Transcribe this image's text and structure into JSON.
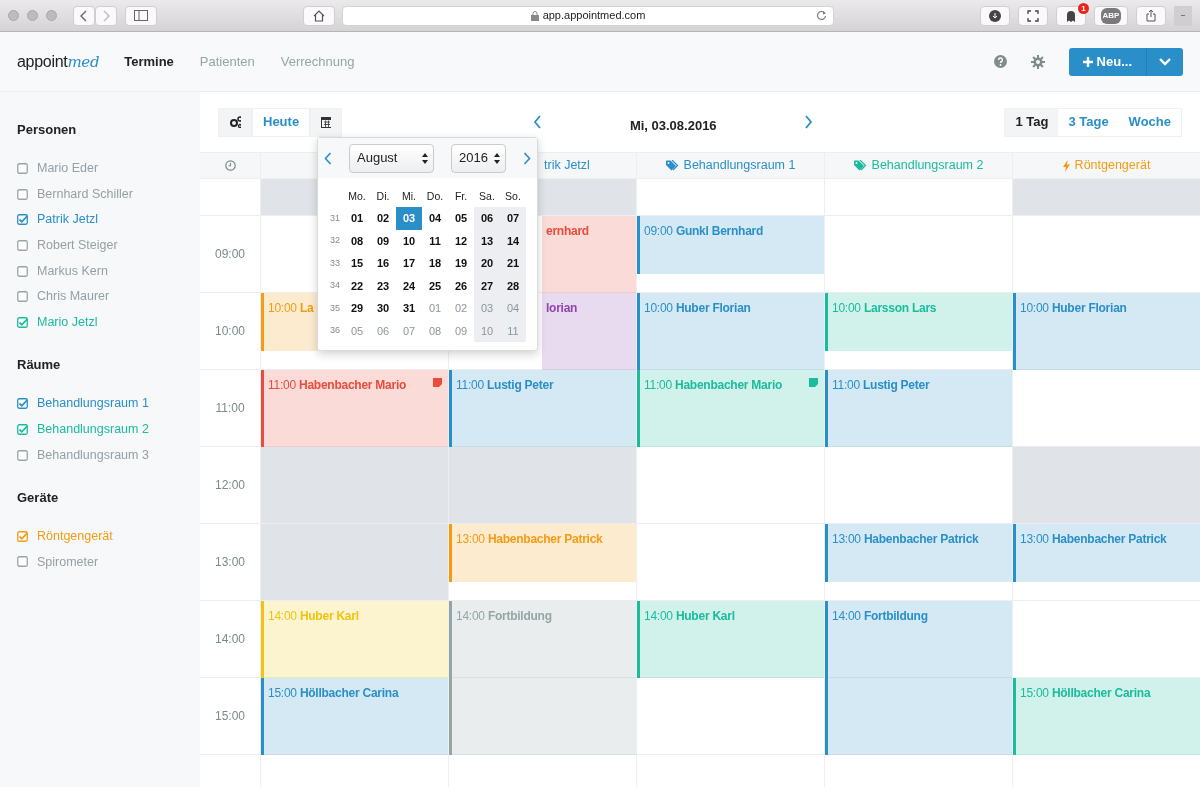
{
  "browser": {
    "url": "app.appointmed.com",
    "notification_count": "1",
    "adblock_label": "ABP"
  },
  "app_nav": {
    "logo": {
      "main": "appoint",
      "accent": "med"
    },
    "items": [
      {
        "label": "Termine",
        "selected": true
      },
      {
        "label": "Patienten",
        "selected": false
      },
      {
        "label": "Verrechnung",
        "selected": false
      }
    ],
    "new_button": {
      "label": "Neu..."
    }
  },
  "sidebar": {
    "sections": [
      {
        "title": "Personen",
        "items": [
          {
            "label": "Mario Eder",
            "checked": false
          },
          {
            "label": "Bernhard Schiller",
            "checked": false
          },
          {
            "label": "Patrik Jetzl",
            "checked": true,
            "color": "#2a8fc8"
          },
          {
            "label": "Robert Steiger",
            "checked": false
          },
          {
            "label": "Markus Kern",
            "checked": false
          },
          {
            "label": "Chris Maurer",
            "checked": false
          },
          {
            "label": "Mario Jetzl",
            "checked": true,
            "color": "#1abc9c"
          }
        ]
      },
      {
        "title": "Räume",
        "items": [
          {
            "label": "Behandlungsraum 1",
            "checked": true,
            "color": "#2a8fc8"
          },
          {
            "label": "Behandlungsraum 2",
            "checked": true,
            "color": "#1abc9c"
          },
          {
            "label": "Behandlungsraum 3",
            "checked": false
          }
        ]
      },
      {
        "title": "Geräte",
        "items": [
          {
            "label": "Röntgengerät",
            "checked": true,
            "color": "#f39c12"
          },
          {
            "label": "Spirometer",
            "checked": false
          }
        ]
      }
    ]
  },
  "toolbar": {
    "today_button": "Heute",
    "date": "Mi, 03.08.2016",
    "views": [
      {
        "label": "1 Tag",
        "selected": true
      },
      {
        "label": "3 Tage",
        "selected": false
      },
      {
        "label": "Woche",
        "selected": false
      }
    ]
  },
  "datepicker": {
    "month": "August",
    "year": "2016",
    "weekdays": [
      "Mo.",
      "Di.",
      "Mi.",
      "Do.",
      "Fr.",
      "Sa.",
      "So."
    ],
    "weeks": [
      {
        "week": "31",
        "days": [
          {
            "label": "01",
            "muted": false,
            "selected": false
          },
          {
            "label": "02",
            "muted": false,
            "selected": false
          },
          {
            "label": "03",
            "muted": false,
            "selected": true
          },
          {
            "label": "04",
            "muted": false,
            "selected": false
          },
          {
            "label": "05",
            "muted": false,
            "selected": false
          },
          {
            "label": "06",
            "muted": false,
            "selected": false
          },
          {
            "label": "07",
            "muted": false,
            "selected": false
          }
        ]
      },
      {
        "week": "32",
        "days": [
          {
            "label": "08",
            "muted": false,
            "selected": false
          },
          {
            "label": "09",
            "muted": false,
            "selected": false
          },
          {
            "label": "10",
            "muted": false,
            "selected": false
          },
          {
            "label": "11",
            "muted": false,
            "selected": false
          },
          {
            "label": "12",
            "muted": false,
            "selected": false
          },
          {
            "label": "13",
            "muted": false,
            "selected": false
          },
          {
            "label": "14",
            "muted": false,
            "selected": false
          }
        ]
      },
      {
        "week": "33",
        "days": [
          {
            "label": "15",
            "muted": false,
            "selected": false
          },
          {
            "label": "16",
            "muted": false,
            "selected": false
          },
          {
            "label": "17",
            "muted": false,
            "selected": false
          },
          {
            "label": "18",
            "muted": false,
            "selected": false
          },
          {
            "label": "19",
            "muted": false,
            "selected": false
          },
          {
            "label": "20",
            "muted": false,
            "selected": false
          },
          {
            "label": "21",
            "muted": false,
            "selected": false
          }
        ]
      },
      {
        "week": "34",
        "days": [
          {
            "label": "22",
            "muted": false,
            "selected": false
          },
          {
            "label": "23",
            "muted": false,
            "selected": false
          },
          {
            "label": "24",
            "muted": false,
            "selected": false
          },
          {
            "label": "25",
            "muted": false,
            "selected": false
          },
          {
            "label": "26",
            "muted": false,
            "selected": false
          },
          {
            "label": "27",
            "muted": false,
            "selected": false
          },
          {
            "label": "28",
            "muted": false,
            "selected": false
          }
        ]
      },
      {
        "week": "35",
        "days": [
          {
            "label": "29",
            "muted": false,
            "selected": false
          },
          {
            "label": "30",
            "muted": false,
            "selected": false
          },
          {
            "label": "31",
            "muted": false,
            "selected": false
          },
          {
            "label": "01",
            "muted": true,
            "selected": false
          },
          {
            "label": "02",
            "muted": true,
            "selected": false
          },
          {
            "label": "03",
            "muted": true,
            "selected": false
          },
          {
            "label": "04",
            "muted": true,
            "selected": false
          }
        ]
      },
      {
        "week": "36",
        "days": [
          {
            "label": "05",
            "muted": true,
            "selected": false
          },
          {
            "label": "06",
            "muted": true,
            "selected": false
          },
          {
            "label": "07",
            "muted": true,
            "selected": false
          },
          {
            "label": "08",
            "muted": true,
            "selected": false
          },
          {
            "label": "09",
            "muted": true,
            "selected": false
          },
          {
            "label": "10",
            "muted": true,
            "selected": false
          },
          {
            "label": "11",
            "muted": true,
            "selected": false
          }
        ]
      }
    ]
  },
  "calendar": {
    "columns": [
      {
        "kind": "hidden"
      },
      {
        "kind": "covered",
        "label": "trik Jetzl",
        "color": "#2a8fc8"
      },
      {
        "kind": "tag",
        "label": "Behandlungsraum 1",
        "color": "#2a8fc8"
      },
      {
        "kind": "tag",
        "label": "Behandlungsraum 2",
        "color": "#1abc9c"
      },
      {
        "kind": "bolt",
        "label": "Röntgengerät",
        "color": "#f39c12"
      }
    ],
    "all_day": [
      {
        "shaded": true
      },
      {
        "shaded": true
      },
      {
        "shaded": false
      },
      {
        "shaded": false
      },
      {
        "shaded": true
      }
    ],
    "rows": [
      {
        "time": "09:00",
        "cells": [
          {
            "shaded": false
          },
          {
            "event": {
              "name": "ernhard",
              "color": "#e74c3c",
              "kind": "hour",
              "note": false
            }
          },
          {
            "event": {
              "time": "09:00",
              "name": "Gunkl Bernhard",
              "color": "#2a8fc8",
              "kind": "short",
              "note": false
            }
          },
          {
            "shaded": false
          },
          {
            "shaded": false
          }
        ]
      },
      {
        "time": "10:00",
        "cells": [
          {
            "event": {
              "time": "10:00",
              "name": "La",
              "color": "#f39c12",
              "kind": "short"
            }
          },
          {
            "event": {
              "name": "lorian",
              "color": "#8e44ad",
              "kind": "hour",
              "note": false
            }
          },
          {
            "event": {
              "time": "10:00",
              "name": "Huber Florian",
              "color": "#2a8fc8",
              "kind": "hour",
              "note": false
            }
          },
          {
            "event": {
              "time": "10:00",
              "name": "Larsson Lars",
              "color": "#1abc9c",
              "kind": "short",
              "note": false
            }
          },
          {
            "event": {
              "time": "10:00",
              "name": "Huber Florian",
              "color": "#2a8fc8",
              "kind": "hour",
              "note": false
            }
          }
        ]
      },
      {
        "time": "11:00",
        "cells": [
          {
            "event": {
              "time": "11:00",
              "name": "Habenbacher Mario",
              "color": "#e74c3c",
              "kind": "hour",
              "note": true
            }
          },
          {
            "event": {
              "time": "11:00",
              "name": "Lustig Peter",
              "color": "#2a8fc8",
              "kind": "hour",
              "note": false
            }
          },
          {
            "event": {
              "time": "11:00",
              "name": "Habenbacher Mario",
              "color": "#1abc9c",
              "kind": "hour",
              "note": true
            }
          },
          {
            "event": {
              "time": "11:00",
              "name": "Lustig Peter",
              "color": "#2a8fc8",
              "kind": "hour",
              "note": false
            }
          },
          {
            "shaded": false
          }
        ]
      },
      {
        "time": "12:00",
        "cells": [
          {
            "shaded": true
          },
          {
            "shaded": true
          },
          {
            "shaded": false
          },
          {
            "shaded": false
          },
          {
            "shaded": true
          }
        ]
      },
      {
        "time": "13:00",
        "cells": [
          {
            "shaded": true
          },
          {
            "event": {
              "time": "13:00",
              "name": "Habenbacher Patrick",
              "color": "#f39c12",
              "kind": "short",
              "note": false
            }
          },
          {
            "shaded": false
          },
          {
            "event": {
              "time": "13:00",
              "name": "Habenbacher Patrick",
              "color": "#2a8fc8",
              "kind": "short",
              "note": false
            }
          },
          {
            "event": {
              "time": "13:00",
              "name": "Habenbacher Patrick",
              "color": "#2a8fc8",
              "kind": "short",
              "note": false
            }
          }
        ]
      },
      {
        "time": "14:00",
        "cells": [
          {
            "event": {
              "time": "14:00",
              "name": "Huber Karl",
              "color": "#f1c40f",
              "kind": "hour",
              "note": false
            }
          },
          {
            "event": {
              "time": "14:00",
              "name": "Fortbildung",
              "color": "#95a5a6",
              "kind": "double",
              "note": false
            }
          },
          {
            "event": {
              "time": "14:00",
              "name": "Huber Karl",
              "color": "#1abc9c",
              "kind": "hour",
              "note": false
            }
          },
          {
            "event": {
              "time": "14:00",
              "name": "Fortbildung",
              "color": "#2a8fc8",
              "kind": "double",
              "note": false
            }
          },
          {
            "shaded": false
          }
        ]
      },
      {
        "time": "15:00",
        "cells": [
          {
            "event": {
              "time": "15:00",
              "name": "Höllbacher Carina",
              "color": "#2a8fc8",
              "kind": "hour",
              "note": false
            }
          },
          {
            "shaded": false
          },
          {
            "shaded": false
          },
          {
            "shaded": false
          },
          {
            "event": {
              "time": "15:00",
              "name": "Höllbacher Carina",
              "color": "#1abc9c",
              "kind": "hour",
              "note": false
            }
          }
        ]
      }
    ]
  }
}
